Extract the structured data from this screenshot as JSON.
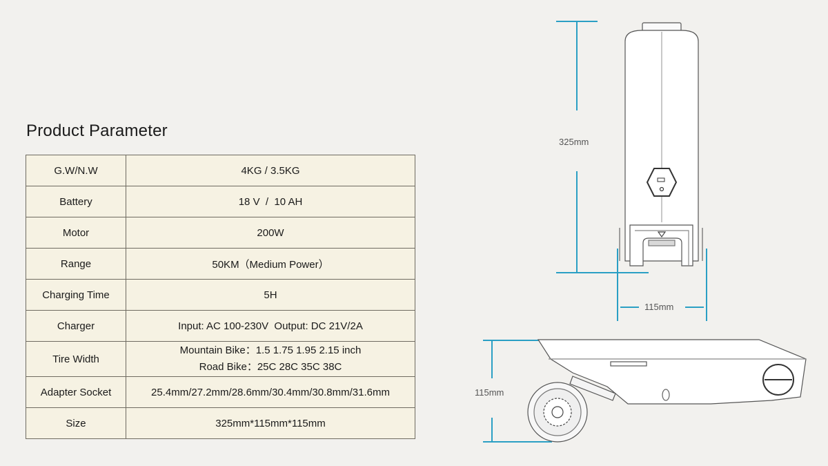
{
  "title": "Product Parameter",
  "parameters": [
    {
      "label": "G.W/N.W",
      "value": "4KG / 3.5KG"
    },
    {
      "label": "Battery",
      "value": "18 V  /  10 AH"
    },
    {
      "label": "Motor",
      "value": "200W"
    },
    {
      "label": "Range",
      "value": "50KM（Medium Power）"
    },
    {
      "label": "Charging Time",
      "value": "5H"
    },
    {
      "label": "Charger",
      "value": "Input: AC 100-230V  Output: DC 21V/2A"
    },
    {
      "label": "Tire Width",
      "value_line1": "Mountain Bike：1.5 1.75 1.95 2.15 inch",
      "value_line2": "Road Bike：25C 28C 35C 38C"
    },
    {
      "label": "Adapter Socket",
      "value": "25.4mm/27.2mm/28.6mm/30.4mm/30.8mm/31.6mm"
    },
    {
      "label": "Size",
      "value": "325mm*115mm*115mm"
    }
  ],
  "dimensions": {
    "height": "325mm",
    "width": "115mm",
    "side_height": "115mm"
  },
  "colors": {
    "dimension_line": "#2a9fc4",
    "table_bg": "#f6f2e3",
    "page_bg": "#f2f1ee"
  }
}
